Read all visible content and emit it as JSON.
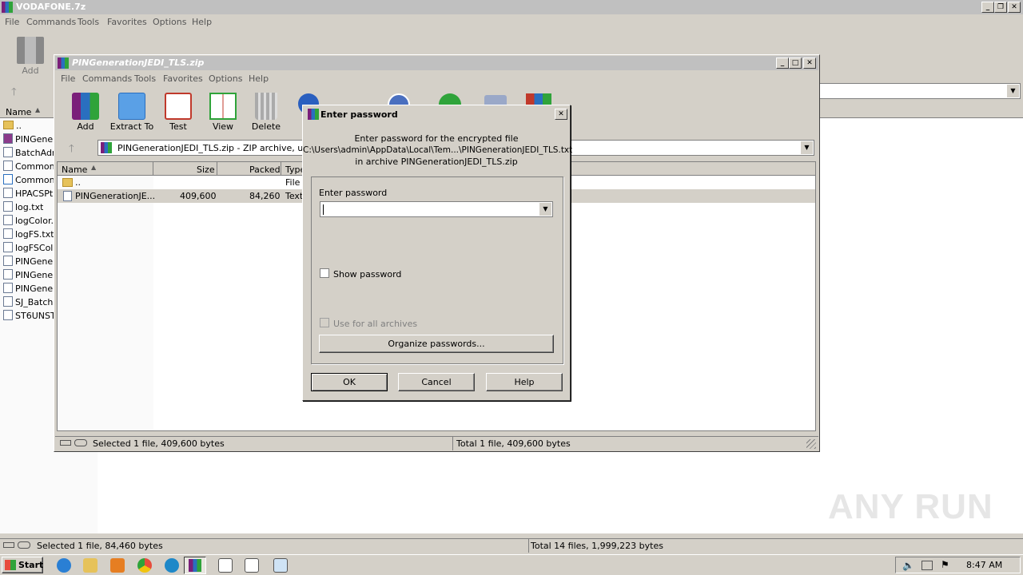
{
  "main_window": {
    "title": "VODAFONE.7z",
    "menu": [
      "File",
      "Commands",
      "Tools",
      "Favorites",
      "Options",
      "Help"
    ],
    "toolbar_add_label": "Add",
    "column_name": "Name",
    "files": [
      "..",
      "PINGene",
      "BatchAdr",
      "Common",
      "Common",
      "HPACSPt",
      "log.txt",
      "logColor.",
      "logFS.txt",
      "logFSCol",
      "PINGene",
      "PINGene",
      "PINGene",
      "SJ_Batch",
      "ST6UNST"
    ],
    "status_left": "Selected 1 file, 84,460 bytes",
    "status_right": "Total 14 files, 1,999,223 bytes"
  },
  "inner_window": {
    "title": "PINGenerationJEDI_TLS.zip",
    "menu": [
      "File",
      "Commands",
      "Tools",
      "Favorites",
      "Options",
      "Help"
    ],
    "toolbar": [
      "Add",
      "Extract To",
      "Test",
      "View",
      "Delete"
    ],
    "path": "PINGenerationJEDI_TLS.zip - ZIP archive, unpac",
    "columns": [
      "Name",
      "Size",
      "Packed",
      "Type"
    ],
    "rows": [
      {
        "name": "..",
        "size": "",
        "packed": "",
        "type": "File"
      },
      {
        "name": "PINGenerationJE...",
        "size": "409,600",
        "packed": "84,260",
        "type": "Text"
      }
    ],
    "status_left": "Selected 1 file, 409,600 bytes",
    "status_right": "Total 1 file, 409,600 bytes"
  },
  "dialog": {
    "title": "Enter password",
    "message_line1": "Enter password for the encrypted file",
    "message_line2": "C:\\Users\\admin\\AppData\\Local\\Tem...\\PINGenerationJEDI_TLS.txt",
    "message_line3": "in archive PINGenerationJEDI_TLS.zip",
    "password_label": "Enter password",
    "password_value": "",
    "show_password_label": "Show password",
    "use_all_label": "Use for all archives",
    "organize_label": "Organize passwords...",
    "ok_label": "OK",
    "cancel_label": "Cancel",
    "help_label": "Help"
  },
  "taskbar": {
    "start_label": "Start",
    "clock": "8:47 AM"
  },
  "watermark": "ANY RUN"
}
